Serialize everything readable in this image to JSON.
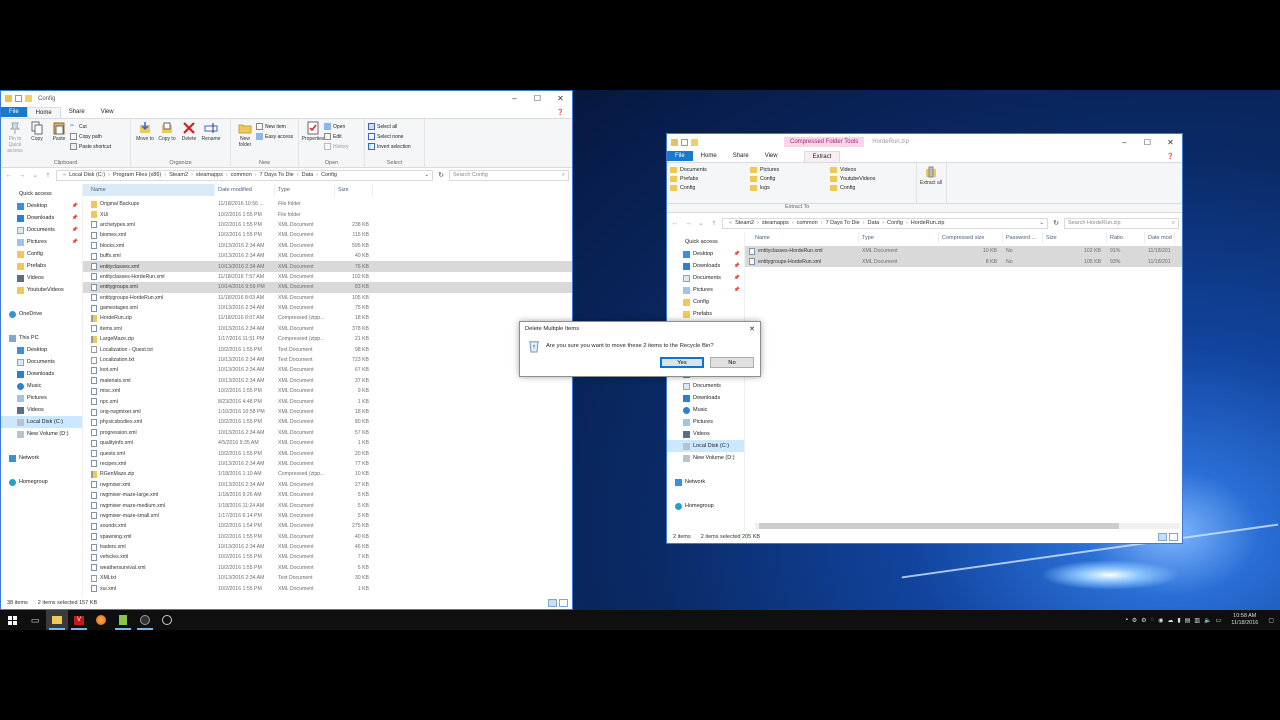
{
  "left_window": {
    "title": "Config",
    "ribbon_tabs": [
      "File",
      "Home",
      "Share",
      "View"
    ],
    "ribbon": {
      "clipboard": {
        "label": "Clipboard",
        "pin": "Pin to Quick access",
        "copy": "Copy",
        "paste": "Paste",
        "cut": "Cut",
        "copy_path": "Copy path",
        "paste_shortcut": "Paste shortcut"
      },
      "organize": {
        "label": "Organize",
        "move_to": "Move to",
        "copy_to": "Copy to",
        "delete": "Delete",
        "rename": "Rename"
      },
      "new": {
        "label": "New",
        "new_folder": "New folder",
        "new_item": "New item",
        "easy_access": "Easy access"
      },
      "open": {
        "label": "Open",
        "properties": "Properties",
        "open": "Open",
        "edit": "Edit",
        "history": "History"
      },
      "select": {
        "label": "Select",
        "select_all": "Select all",
        "select_none": "Select none",
        "invert": "Invert selection"
      }
    },
    "address": [
      "Local Disk (C:)",
      "Program Files (x86)",
      "Steam2",
      "steamapps",
      "common",
      "7 Days To Die",
      "Data",
      "Config"
    ],
    "search_placeholder": "Search Config",
    "nav": [
      {
        "label": "Quick access",
        "icon": "star-icon",
        "indent": 0,
        "pin": false
      },
      {
        "label": "Desktop",
        "icon": "desktop-icon",
        "indent": 1,
        "pin": true
      },
      {
        "label": "Downloads",
        "icon": "download-icon",
        "indent": 1,
        "pin": true
      },
      {
        "label": "Documents",
        "icon": "documents-icon",
        "indent": 1,
        "pin": true
      },
      {
        "label": "Pictures",
        "icon": "pictures-icon",
        "indent": 1,
        "pin": true
      },
      {
        "label": "Config",
        "icon": "folder-icon",
        "indent": 1,
        "pin": false
      },
      {
        "label": "Prefabs",
        "icon": "folder-icon",
        "indent": 1,
        "pin": false
      },
      {
        "label": "Videos",
        "icon": "videos-icon",
        "indent": 1,
        "pin": false
      },
      {
        "label": "YoutubeVideos",
        "icon": "folder-icon",
        "indent": 1,
        "pin": false
      },
      {
        "label": "",
        "icon": "",
        "indent": 0,
        "pin": false
      },
      {
        "label": "OneDrive",
        "icon": "cloud-icon",
        "indent": 0,
        "pin": false
      },
      {
        "label": "",
        "icon": "",
        "indent": 0,
        "pin": false
      },
      {
        "label": "This PC",
        "icon": "pc-icon",
        "indent": 0,
        "pin": false
      },
      {
        "label": "Desktop",
        "icon": "desktop-icon",
        "indent": 1,
        "pin": false
      },
      {
        "label": "Documents",
        "icon": "documents-icon",
        "indent": 1,
        "pin": false
      },
      {
        "label": "Downloads",
        "icon": "download-icon",
        "indent": 1,
        "pin": false
      },
      {
        "label": "Music",
        "icon": "music-icon",
        "indent": 1,
        "pin": false
      },
      {
        "label": "Pictures",
        "icon": "pictures-icon",
        "indent": 1,
        "pin": false
      },
      {
        "label": "Videos",
        "icon": "videos-icon",
        "indent": 1,
        "pin": false
      },
      {
        "label": "Local Disk (C:)",
        "icon": "drive-icon",
        "indent": 1,
        "pin": false,
        "selected": true
      },
      {
        "label": "New Volume (D:)",
        "icon": "drive-icon",
        "indent": 1,
        "pin": false
      },
      {
        "label": "",
        "icon": "",
        "indent": 0,
        "pin": false
      },
      {
        "label": "Network",
        "icon": "network-icon",
        "indent": 0,
        "pin": false
      },
      {
        "label": "",
        "icon": "",
        "indent": 0,
        "pin": false
      },
      {
        "label": "Homegroup",
        "icon": "homegroup-icon",
        "indent": 0,
        "pin": false
      }
    ],
    "columns": [
      "Name",
      "Date modified",
      "Type",
      "Size"
    ],
    "files": [
      {
        "name": "Original Backups",
        "date": "11/18/2016 10:56 ...",
        "type": "File folder",
        "size": "",
        "kind": "folder"
      },
      {
        "name": "XUi",
        "date": "10/2/2016 1:55 PM",
        "type": "File folder",
        "size": "",
        "kind": "folder"
      },
      {
        "name": "archetypes.xml",
        "date": "10/2/2016 1:55 PM",
        "type": "XML Document",
        "size": "238 KB",
        "kind": "xml"
      },
      {
        "name": "biomes.xml",
        "date": "10/2/2016 1:55 PM",
        "type": "XML Document",
        "size": "115 KB",
        "kind": "xml"
      },
      {
        "name": "blocks.xml",
        "date": "10/13/2016 2:34 AM",
        "type": "XML Document",
        "size": "595 KB",
        "kind": "xml"
      },
      {
        "name": "buffs.xml",
        "date": "10/13/2016 2:34 AM",
        "type": "XML Document",
        "size": "40 KB",
        "kind": "xml"
      },
      {
        "name": "entityclasses.xml",
        "date": "10/13/2016 2:34 AM",
        "type": "XML Document",
        "size": "76 KB",
        "kind": "xml",
        "selected": true
      },
      {
        "name": "entityclasses-HordeRun.xml",
        "date": "11/18/2016 7:57 AM",
        "type": "XML Document",
        "size": "102 KB",
        "kind": "xml"
      },
      {
        "name": "entitygroups.xml",
        "date": "10/14/2016 9:59 PM",
        "type": "XML Document",
        "size": "83 KB",
        "kind": "xml",
        "selected": true
      },
      {
        "name": "entitygroups-HordeRun.xml",
        "date": "11/18/2016 8:03 AM",
        "type": "XML Document",
        "size": "105 KB",
        "kind": "xml"
      },
      {
        "name": "gamestages.xml",
        "date": "10/13/2016 2:34 AM",
        "type": "XML Document",
        "size": "75 KB",
        "kind": "xml"
      },
      {
        "name": "HordeRun.zip",
        "date": "11/18/2016 8:07 AM",
        "type": "Compressed (zipp...",
        "size": "18 KB",
        "kind": "zip"
      },
      {
        "name": "items.xml",
        "date": "10/13/2016 2:34 AM",
        "type": "XML Document",
        "size": "378 KB",
        "kind": "xml"
      },
      {
        "name": "LargeMaze.zip",
        "date": "1/17/2016 11:51 PM",
        "type": "Compressed (zipp...",
        "size": "21 KB",
        "kind": "zip"
      },
      {
        "name": "Localization - Quest.txt",
        "date": "10/2/2016 1:55 PM",
        "type": "Text Document",
        "size": "98 KB",
        "kind": "txt"
      },
      {
        "name": "Localization.txt",
        "date": "10/13/2016 2:34 AM",
        "type": "Text Document",
        "size": "723 KB",
        "kind": "txt"
      },
      {
        "name": "loot.xml",
        "date": "10/13/2016 2:34 AM",
        "type": "XML Document",
        "size": "67 KB",
        "kind": "xml"
      },
      {
        "name": "materials.xml",
        "date": "10/13/2016 2:34 AM",
        "type": "XML Document",
        "size": "37 KB",
        "kind": "xml"
      },
      {
        "name": "misc.xml",
        "date": "10/2/2016 1:55 PM",
        "type": "XML Document",
        "size": "9 KB",
        "kind": "xml"
      },
      {
        "name": "npc.xml",
        "date": "8/23/2016 4:48 PM",
        "type": "XML Document",
        "size": "1 KB",
        "kind": "xml"
      },
      {
        "name": "orig-rwgmixer.xml",
        "date": "1/10/2016 10:58 PM",
        "type": "XML Document",
        "size": "18 KB",
        "kind": "xml"
      },
      {
        "name": "physicsbodies.xml",
        "date": "10/2/2016 1:55 PM",
        "type": "XML Document",
        "size": "80 KB",
        "kind": "xml"
      },
      {
        "name": "progression.xml",
        "date": "10/13/2016 2:34 AM",
        "type": "XML Document",
        "size": "57 KB",
        "kind": "xml"
      },
      {
        "name": "qualityinfo.xml",
        "date": "4/5/2016 9:35 AM",
        "type": "XML Document",
        "size": "1 KB",
        "kind": "xml"
      },
      {
        "name": "quests.xml",
        "date": "10/2/2016 1:55 PM",
        "type": "XML Document",
        "size": "20 KB",
        "kind": "xml"
      },
      {
        "name": "recipes.xml",
        "date": "10/13/2016 2:34 AM",
        "type": "XML Document",
        "size": "77 KB",
        "kind": "xml"
      },
      {
        "name": "RGenMaze.zip",
        "date": "1/18/2016 1:10 AM",
        "type": "Compressed (zipp...",
        "size": "10 KB",
        "kind": "zip"
      },
      {
        "name": "rwgmixer.xml",
        "date": "10/13/2016 2:34 AM",
        "type": "XML Document",
        "size": "27 KB",
        "kind": "xml"
      },
      {
        "name": "rwgmixer-maze-large.xml",
        "date": "1/18/2016 9:26 AM",
        "type": "XML Document",
        "size": "5 KB",
        "kind": "xml"
      },
      {
        "name": "rwgmixer-maze-medium.xml",
        "date": "1/18/2016 11:24 AM",
        "type": "XML Document",
        "size": "5 KB",
        "kind": "xml"
      },
      {
        "name": "rwgmixer-maze-small.xml",
        "date": "1/17/2016 6:14 PM",
        "type": "XML Document",
        "size": "5 KB",
        "kind": "xml"
      },
      {
        "name": "sounds.xml",
        "date": "10/2/2016 1:54 PM",
        "type": "XML Document",
        "size": "275 KB",
        "kind": "xml"
      },
      {
        "name": "spawning.xml",
        "date": "10/2/2016 1:55 PM",
        "type": "XML Document",
        "size": "40 KB",
        "kind": "xml"
      },
      {
        "name": "traders.xml",
        "date": "10/13/2016 2:34 AM",
        "type": "XML Document",
        "size": "46 KB",
        "kind": "xml"
      },
      {
        "name": "vehicles.xml",
        "date": "10/2/2016 1:55 PM",
        "type": "XML Document",
        "size": "7 KB",
        "kind": "xml"
      },
      {
        "name": "weathersurvival.xml",
        "date": "10/2/2016 1:55 PM",
        "type": "XML Document",
        "size": "5 KB",
        "kind": "xml"
      },
      {
        "name": "XMLtxt",
        "date": "10/13/2016 2:34 AM",
        "type": "Text Document",
        "size": "30 KB",
        "kind": "txt"
      },
      {
        "name": "xui.xml",
        "date": "10/2/2016 1:55 PM",
        "type": "XML Document",
        "size": "1 KB",
        "kind": "xml"
      }
    ],
    "status": {
      "count": "38 items",
      "selected": "2 items selected  157 KB"
    }
  },
  "right_window": {
    "title": "HordeRun.zip",
    "context_tab": "Compressed Folder Tools",
    "ribbon_tabs": [
      "File",
      "Home",
      "Share",
      "View",
      "Extract"
    ],
    "extract_to": {
      "label": "Extract To",
      "items": [
        "Documents",
        "Prefabs",
        "Config",
        "Pictures",
        "Config",
        "logs",
        "Videos",
        "YoutubeVideos",
        "Config"
      ],
      "extract_all": "Extract all"
    },
    "address": [
      "Steam2",
      "steamapps",
      "common",
      "7 Days To Die",
      "Data",
      "Config",
      "HordeRun.zip"
    ],
    "search_placeholder": "Search HordeRun.zip",
    "nav": [
      {
        "label": "Quick access",
        "icon": "star-icon",
        "indent": 0,
        "pin": false
      },
      {
        "label": "Desktop",
        "icon": "desktop-icon",
        "indent": 1,
        "pin": true
      },
      {
        "label": "Downloads",
        "icon": "download-icon",
        "indent": 1,
        "pin": true
      },
      {
        "label": "Documents",
        "icon": "documents-icon",
        "indent": 1,
        "pin": true
      },
      {
        "label": "Pictures",
        "icon": "pictures-icon",
        "indent": 1,
        "pin": true
      },
      {
        "label": "Config",
        "icon": "folder-icon",
        "indent": 1,
        "pin": false
      },
      {
        "label": "Prefabs",
        "icon": "folder-icon",
        "indent": 1,
        "pin": false
      },
      {
        "label": "",
        "icon": "",
        "indent": 0,
        "pin": false
      },
      {
        "label": "",
        "icon": "",
        "indent": 0,
        "pin": false
      },
      {
        "label": "",
        "icon": "",
        "indent": 0,
        "pin": false
      },
      {
        "label": "",
        "icon": "",
        "indent": 0,
        "pin": false
      },
      {
        "label": "Desktop",
        "icon": "desktop-icon",
        "indent": 1,
        "pin": false
      },
      {
        "label": "Documents",
        "icon": "documents-icon",
        "indent": 1,
        "pin": false
      },
      {
        "label": "Downloads",
        "icon": "download-icon",
        "indent": 1,
        "pin": false
      },
      {
        "label": "Music",
        "icon": "music-icon",
        "indent": 1,
        "pin": false
      },
      {
        "label": "Pictures",
        "icon": "pictures-icon",
        "indent": 1,
        "pin": false
      },
      {
        "label": "Videos",
        "icon": "videos-icon",
        "indent": 1,
        "pin": false
      },
      {
        "label": "Local Disk (C:)",
        "icon": "drive-icon",
        "indent": 1,
        "pin": false,
        "selected": true
      },
      {
        "label": "New Volume (D:)",
        "icon": "drive-icon",
        "indent": 1,
        "pin": false
      },
      {
        "label": "",
        "icon": "",
        "indent": 0,
        "pin": false
      },
      {
        "label": "Network",
        "icon": "network-icon",
        "indent": 0,
        "pin": false
      },
      {
        "label": "",
        "icon": "",
        "indent": 0,
        "pin": false
      },
      {
        "label": "Homegroup",
        "icon": "homegroup-icon",
        "indent": 0,
        "pin": false
      }
    ],
    "columns": [
      "Name",
      "Type",
      "Compressed size",
      "Password ...",
      "Size",
      "Ratio",
      "Date mod"
    ],
    "files": [
      {
        "name": "entityclasses-HordeRun.xml",
        "type": "XML Document",
        "csize": "10 KB",
        "pw": "No",
        "size": "102 KB",
        "ratio": "91%",
        "date": "11/18/201"
      },
      {
        "name": "entitygroups-HordeRun.xml",
        "type": "XML Document",
        "csize": "8 KB",
        "pw": "No",
        "size": "105 KB",
        "ratio": "93%",
        "date": "11/18/201"
      }
    ],
    "status": {
      "count": "2 items",
      "selected": "2 items selected  205 KB"
    }
  },
  "dialog": {
    "title": "Delete Multiple Items",
    "message": "Are you sure you want to move these 2 items to the Recycle Bin?",
    "yes": "Yes",
    "no": "No"
  },
  "taskbar": {
    "apps": [
      "start-icon",
      "task-view-icon",
      "file-explorer-icon",
      "vegas-icon",
      "firefox-icon",
      "notepad-plus-icon",
      "obs-icon",
      "steam-icon"
    ],
    "time": "10:58 AM",
    "date": "11/18/2016"
  },
  "colors": {
    "accent": "#1979ca",
    "selection": "#cce8ff",
    "row_selected": "#d9d9d9",
    "context_tab": "#f9d5ea"
  }
}
